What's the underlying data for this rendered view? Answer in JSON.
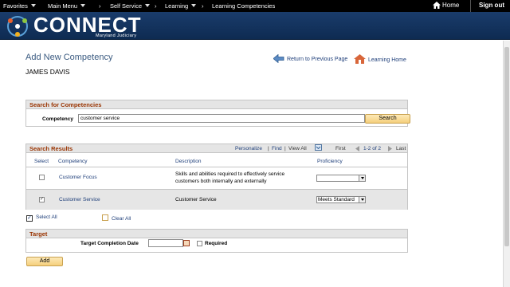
{
  "topnav": {
    "favorites": "Favorites",
    "main_menu": "Main Menu",
    "self_service": "Self Service",
    "learning": "Learning",
    "current": "Learning Competencies",
    "home": "Home",
    "sign_out": "Sign out"
  },
  "brand": {
    "name": "CONNECT",
    "sub": "Maryland Judiciary"
  },
  "page": {
    "title": "Add New Competency",
    "student_name": "JAMES DAVIS",
    "return_link": "Return to Previous Page",
    "learning_home": "Learning Home"
  },
  "search": {
    "header": "Search for Competencies",
    "label": "Competency",
    "value": "customer service",
    "button": "Search"
  },
  "results": {
    "header": "Search Results",
    "personalize": "Personalize",
    "find": "Find",
    "view_all": "View All",
    "first": "First",
    "range": "1-2 of 2",
    "last": "Last",
    "columns": {
      "select": "Select",
      "competency": "Competency",
      "description": "Description",
      "proficiency": "Proficiency"
    },
    "rows": [
      {
        "competency": "Customer Focus",
        "description_1": "Skills and abilities required to effectively service",
        "description_2": "customers both internally and externally",
        "proficiency": "",
        "checked": false
      },
      {
        "competency": "Customer Service",
        "description_1": "Customer Service",
        "description_2": "",
        "proficiency": "Meets Standard",
        "checked": true
      }
    ],
    "select_all": "Select All",
    "clear_all": "Clear All"
  },
  "target": {
    "header": "Target",
    "label": "Target Completion Date",
    "date_value": "",
    "required": "Required"
  },
  "add_button": "Add"
}
